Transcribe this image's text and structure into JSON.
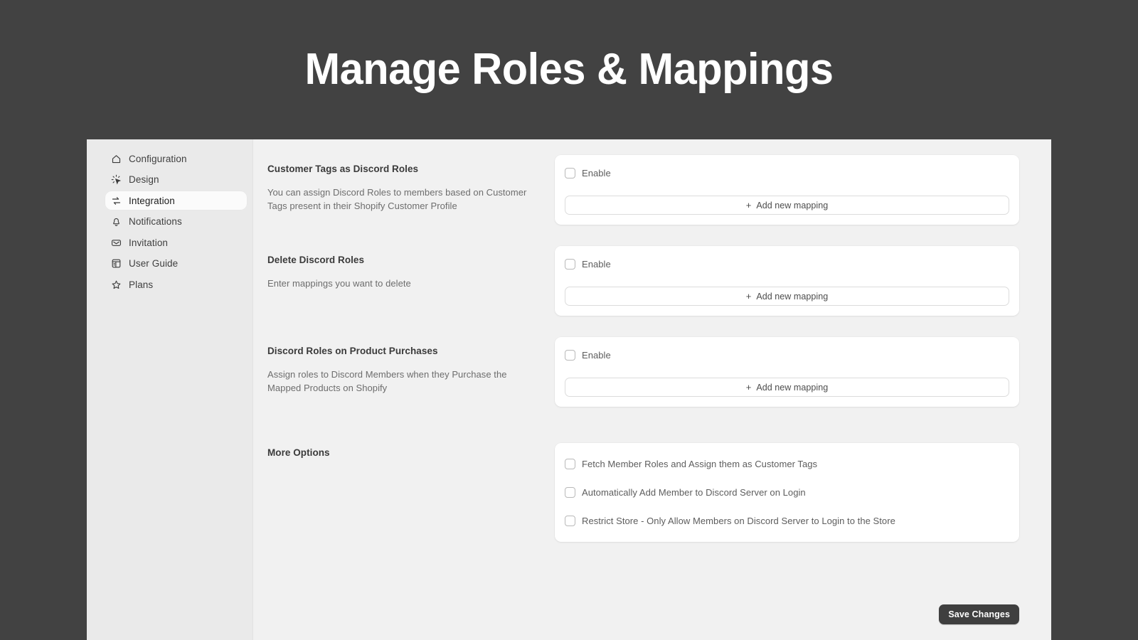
{
  "header": {
    "title": "Manage Roles & Mappings"
  },
  "sidebar": {
    "items": [
      {
        "label": "Configuration",
        "icon": "home-icon",
        "active": false
      },
      {
        "label": "Design",
        "icon": "design-cursor-icon",
        "active": false
      },
      {
        "label": "Integration",
        "icon": "sync-arrows-icon",
        "active": true
      },
      {
        "label": "Notifications",
        "icon": "bell-icon",
        "active": false
      },
      {
        "label": "Invitation",
        "icon": "envelope-icon",
        "active": false
      },
      {
        "label": "User Guide",
        "icon": "book-icon",
        "active": false
      },
      {
        "label": "Plans",
        "icon": "star-icon",
        "active": false
      }
    ]
  },
  "sections": [
    {
      "title": "Customer Tags as Discord Roles",
      "description": "You can assign Discord Roles to members based on Customer Tags present in their Shopify Customer Profile",
      "enable_label": "Enable",
      "enable_checked": false,
      "add_mapping_label": "Add new mapping",
      "add_mapping_plus": "+"
    },
    {
      "title": "Delete Discord Roles",
      "description": "Enter mappings you want to delete",
      "enable_label": "Enable",
      "enable_checked": false,
      "add_mapping_label": "Add new mapping",
      "add_mapping_plus": "+"
    },
    {
      "title": "Discord Roles on Product Purchases",
      "description": "Assign roles to Discord Members when they Purchase the Mapped Products on Shopify",
      "enable_label": "Enable",
      "enable_checked": false,
      "add_mapping_label": "Add new mapping",
      "add_mapping_plus": "+"
    }
  ],
  "more_options": {
    "title": "More Options",
    "options": [
      {
        "label": "Fetch Member Roles and Assign them as Customer Tags",
        "checked": false
      },
      {
        "label": "Automatically Add Member to Discord Server on Login",
        "checked": false
      },
      {
        "label": "Restrict Store - Only Allow Members on Discord Server to Login to the Store",
        "checked": false
      }
    ]
  },
  "footer": {
    "save_label": "Save Changes"
  },
  "colors": {
    "page_background": "#424242",
    "sidebar": "#eaeaea",
    "content": "#f1f1f1",
    "card": "#ffffff",
    "save_button": "#3f3f3f",
    "title_text": "#ffffff"
  }
}
